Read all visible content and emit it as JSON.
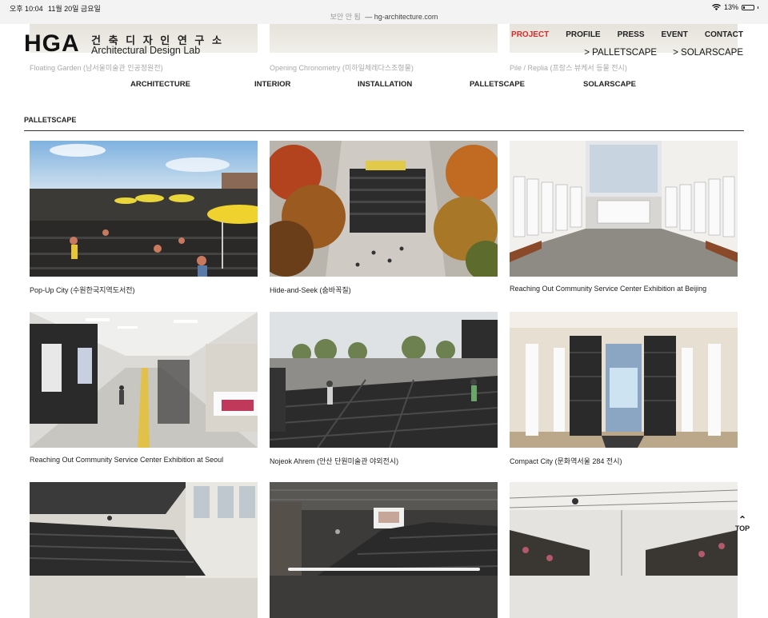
{
  "status": {
    "time": "오후 10:04",
    "date": "11월 20일 금요일",
    "secure": "보안 안 됨",
    "url": "hg-architecture.com",
    "battery": "13%",
    "battery_level": 0.13
  },
  "peek_captions": [
    "Floating Garden (남서울미술관 인공정원전)",
    "Opening Chronometry (미하일체레다스조형물)",
    "Pile / Replia (프랑스 뷰케서 등물 전시)"
  ],
  "logo": {
    "mark": "HGA",
    "korean": "건 축 디 자 인 연 구 소",
    "english": "Architectural Design Lab"
  },
  "nav": {
    "items": [
      "PROJECT",
      "PROFILE",
      "PRESS",
      "EVENT",
      "CONTACT"
    ],
    "sub": [
      "> PALLETSCAPE",
      "> SOLARSCAPE"
    ]
  },
  "categories": [
    "ARCHITECTURE",
    "INTERIOR",
    "INSTALLATION",
    "PALLETSCAPE",
    "SOLARSCAPE"
  ],
  "section": {
    "title": "PALLETSCAPE"
  },
  "projects": [
    {
      "caption": "Pop-Up City (수원한국지역도서전)"
    },
    {
      "caption": "Hide-and-Seek (숨바꼭질)"
    },
    {
      "caption": "Reaching Out Community Service Center Exhibition at Beijing"
    },
    {
      "caption": "Reaching Out Community Service Center Exhibition at Seoul"
    },
    {
      "caption": "Nojeok Ahrem (안산 단원미술관 야외전시)"
    },
    {
      "caption": "Compact City (문화역서울 284 전시)"
    },
    {
      "caption": ""
    },
    {
      "caption": ""
    },
    {
      "caption": ""
    }
  ],
  "scroll_top": {
    "label": "TOP"
  },
  "colors": {
    "accent": "#d62b2b",
    "text": "#222222",
    "background": "#ffffff"
  }
}
